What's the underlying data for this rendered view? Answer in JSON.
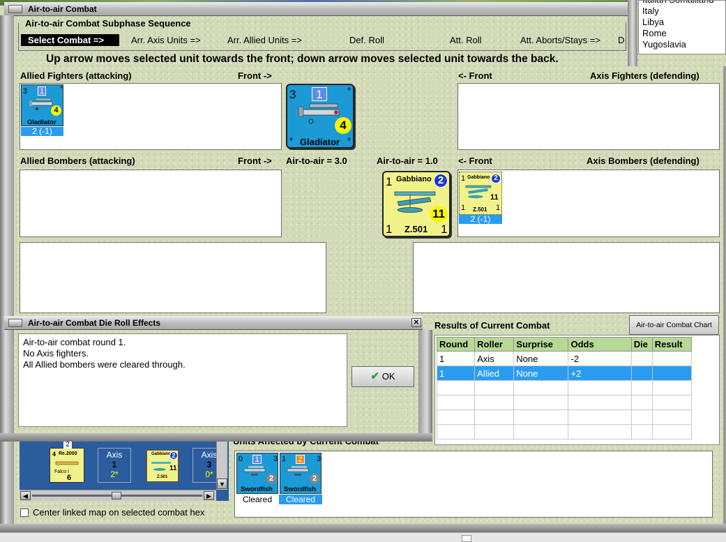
{
  "window": {
    "title": "Air-to-air Combat"
  },
  "subphase": {
    "title": "Air-to-air Combat Subphase Sequence",
    "steps": [
      "Select Combat =>",
      "Arr. Axis Units =>",
      "Arr. Allied Units =>",
      "Def. Roll",
      "Att. Roll",
      "Att. Aborts/Stays =>",
      "D"
    ],
    "active_step": "Select Combat =>"
  },
  "instruction": "Up arrow moves selected unit towards the front; down arrow moves selected unit towards the back.",
  "countries": {
    "partial": "Italian Somaliland",
    "items": [
      "Italy",
      "Libya",
      "Rome",
      "Yugoslavia"
    ]
  },
  "allied_fighters": {
    "label": "Allied Fighters (attacking)",
    "front": "Front ->",
    "unit": {
      "name": "Gladiator",
      "left": "3",
      "top": "1",
      "right": "4",
      "footer": "2 (-1)"
    }
  },
  "selected_fighter": {
    "name": "Gladiator",
    "left": "3",
    "top": "1",
    "right": "4"
  },
  "axis_fighters": {
    "label": "Axis Fighters (defending)",
    "front": "<- Front"
  },
  "allied_bombers": {
    "label": "Allied Bombers (attacking)",
    "front": "Front ->",
    "a2a": "Air-to-air = 3.0"
  },
  "axis_bombers": {
    "label": "Axis Bombers (defending)",
    "front": "<- Front",
    "a2a": "Air-to-air = 1.0",
    "unit": {
      "name": "Gabbiano",
      "model": "Z.501",
      "tl": "1",
      "top": "2",
      "right": "11",
      "bl": "1",
      "br": "1",
      "footer": "2 (-1)"
    }
  },
  "selected_bomber": {
    "name": "Gabbiano",
    "model": "Z.501",
    "tl": "1",
    "top": "2",
    "right": "11",
    "bl": "1",
    "br": "1"
  },
  "die_dialog": {
    "title": "Air-to-air Combat Die Roll Effects",
    "lines": [
      "Air-to-air combat round 1.",
      "No Axis fighters.",
      "All Allied bombers were cleared through."
    ],
    "ok": "OK"
  },
  "results": {
    "title": "Results of Current Combat",
    "chart_button": "Air-to-air Combat Chart",
    "columns": [
      "Round",
      "Roller",
      "Surprise",
      "Odds",
      "Die",
      "Result"
    ],
    "rows": [
      [
        "1",
        "Axis",
        "None",
        "-2",
        "",
        ""
      ],
      [
        "1",
        "Allied",
        "None",
        "+2",
        "",
        ""
      ]
    ]
  },
  "affected": {
    "title": "Units Affected by Current Combat",
    "units": [
      {
        "name": "Swordfish",
        "tl": "0",
        "top": "1",
        "tr": "3",
        "right": "2",
        "status": "Cleared"
      },
      {
        "name": "Swordfish",
        "tl": "1",
        "top": "2",
        "tr": "3",
        "right": "2",
        "status": "Cleared"
      }
    ]
  },
  "minimap": {
    "units": [
      {
        "name": "Re.2000",
        "model": "Falco I",
        "top": "4",
        "right": "6",
        "badge": "2"
      },
      {
        "name": "Gabbiano",
        "model": "Z.501",
        "top": "2",
        "right": "11"
      }
    ],
    "cells": [
      {
        "side": "Axis",
        "n": "1",
        "v": "2*"
      },
      {
        "side": "Axis",
        "n": "3",
        "v": "0*"
      }
    ]
  },
  "center_checkbox": "Center linked map on selected combat hex"
}
